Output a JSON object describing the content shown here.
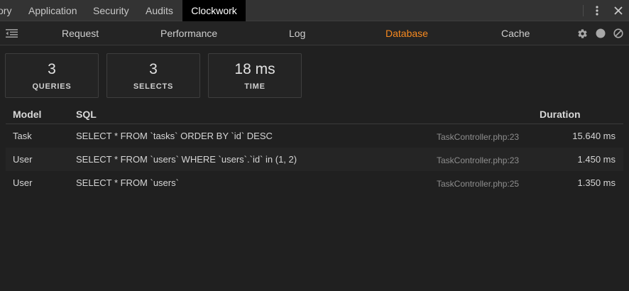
{
  "devtools_tabs": [
    {
      "label": "ory",
      "active": false
    },
    {
      "label": "Application",
      "active": false
    },
    {
      "label": "Security",
      "active": false
    },
    {
      "label": "Audits",
      "active": false
    },
    {
      "label": "Clockwork",
      "active": true
    }
  ],
  "icons": {
    "more": "vertical-dots",
    "close": "x",
    "sidebar_toggle": "list-indent",
    "settings": "gear",
    "record": "filled-circle",
    "clear": "circle-slash"
  },
  "nav": [
    {
      "label": "Request",
      "active": false
    },
    {
      "label": "Performance",
      "active": false
    },
    {
      "label": "Log",
      "active": false
    },
    {
      "label": "Database",
      "active": true
    },
    {
      "label": "Cache",
      "active": false
    }
  ],
  "stats": [
    {
      "value": "3",
      "label": "QUERIES"
    },
    {
      "value": "3",
      "label": "SELECTS"
    },
    {
      "value": "18 ms",
      "label": "TIME"
    }
  ],
  "table": {
    "headers": {
      "model": "Model",
      "sql": "SQL",
      "duration": "Duration"
    },
    "rows": [
      {
        "model": "Task",
        "sql": "SELECT * FROM `tasks` ORDER BY `id` DESC",
        "file": "TaskController.php:23",
        "duration": "15.640 ms"
      },
      {
        "model": "User",
        "sql": "SELECT * FROM `users` WHERE `users`.`id` in (1, 2)",
        "file": "TaskController.php:23",
        "duration": "1.450 ms"
      },
      {
        "model": "User",
        "sql": "SELECT * FROM `users`",
        "file": "TaskController.php:25",
        "duration": "1.350 ms"
      }
    ]
  },
  "colors": {
    "accent": "#f7891f",
    "background": "#202020",
    "toolbar": "#333333",
    "active_tab": "#000000"
  }
}
